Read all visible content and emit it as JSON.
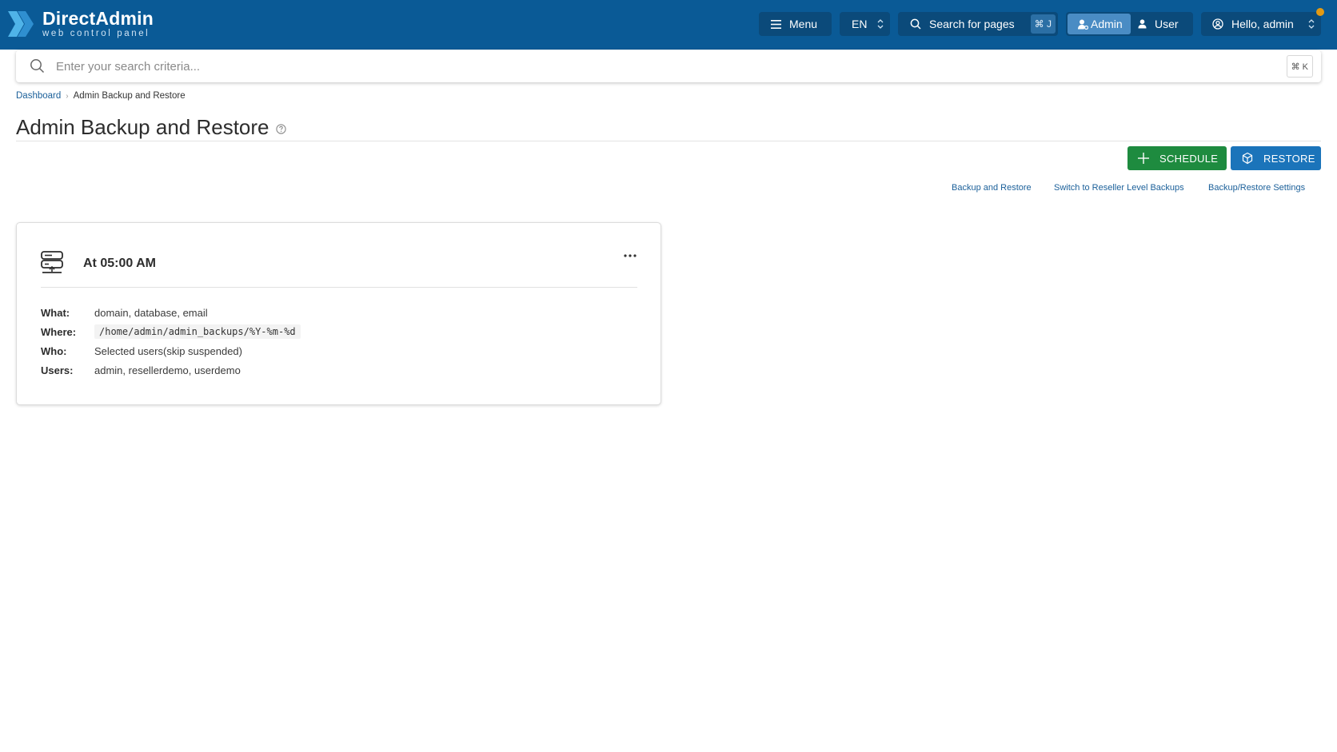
{
  "app": {
    "logo_title": "DirectAdmin",
    "logo_subtitle": "web control panel"
  },
  "topbar": {
    "menu_label": "Menu",
    "language": "EN",
    "search_pages_label": "Search for pages",
    "search_pages_shortcut": "⌘ J",
    "role_admin": "Admin",
    "role_user": "User",
    "user_greeting": "Hello, admin",
    "colors": {
      "bar": "#0a5a96",
      "button": "#0b4a7a",
      "active_role": "#4a8cc4",
      "notification": "#e39a13"
    }
  },
  "search": {
    "placeholder": "Enter your search criteria...",
    "shortcut": "⌘ K"
  },
  "breadcrumb": {
    "items": [
      "Dashboard",
      "Admin Backup and Restore"
    ]
  },
  "page": {
    "title": "Admin Backup and Restore"
  },
  "actions": {
    "schedule_label": "SCHEDULE",
    "restore_label": "RESTORE",
    "colors": {
      "schedule": "#1e8b3f",
      "restore": "#1b74ba"
    }
  },
  "links": {
    "backup_and_restore": "Backup and Restore",
    "switch_reseller": "Switch to Reseller Level Backups",
    "settings": "Backup/Restore Settings"
  },
  "schedule_card": {
    "time": "At 05:00 AM",
    "icon": "server-icon",
    "details": [
      {
        "key": "What:",
        "value": "domain, database, email"
      },
      {
        "key": "Where:",
        "value": "/home/admin/admin_backups/%Y-%m-%d"
      },
      {
        "key": "Who:",
        "value": "Selected users(skip suspended)"
      },
      {
        "key": "Users:",
        "value": "admin, resellerdemo, userdemo"
      }
    ]
  }
}
